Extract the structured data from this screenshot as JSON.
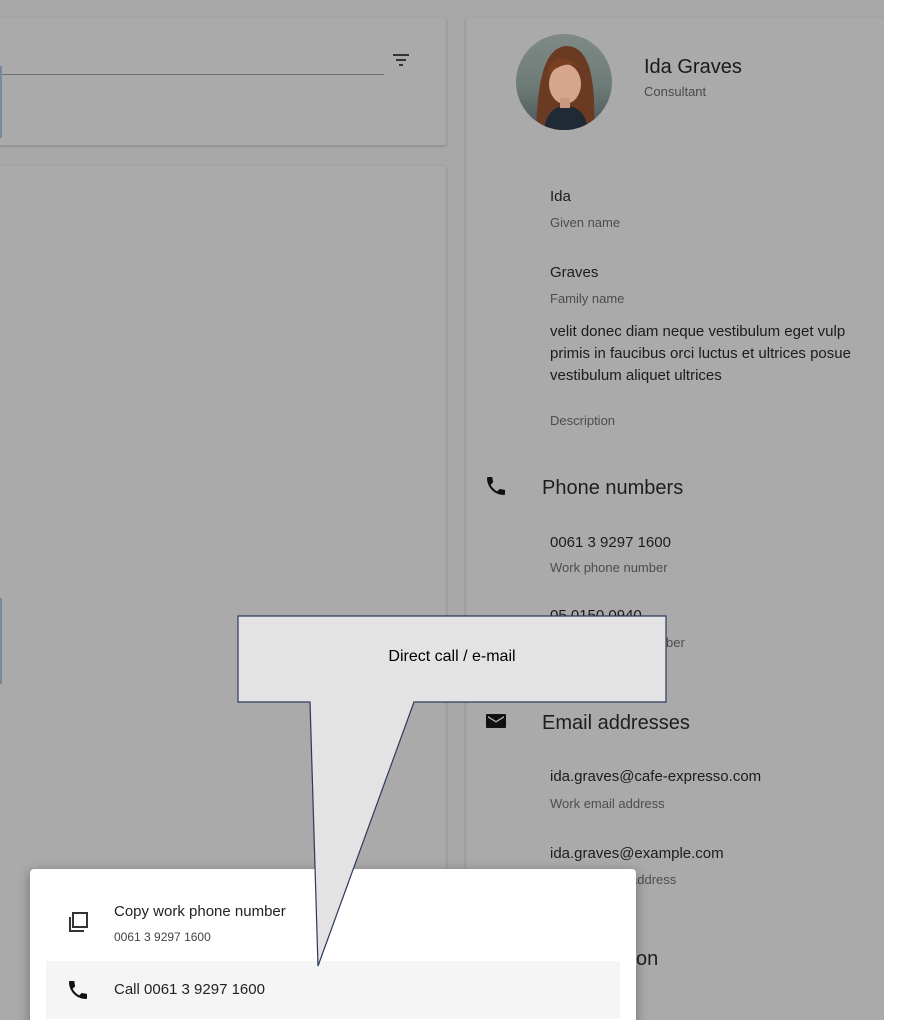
{
  "contact": {
    "name": "Ida Graves",
    "role": "Consultant",
    "fields": {
      "given_name": "Ida",
      "given_name_label": "Given name",
      "family_name": "Graves",
      "family_name_label": "Family name",
      "description_lines": [
        "velit donec diam neque vestibulum eget vulp",
        "primis in faucibus orci luctus et ultrices posue",
        "vestibulum aliquet ultrices"
      ],
      "description_label": "Description"
    },
    "phones": {
      "title": "Phone numbers",
      "items": [
        {
          "value": "0061 3 9297 1600",
          "label": "Work phone number"
        },
        {
          "value": "05 0150 0940",
          "label": "ber"
        }
      ]
    },
    "emails": {
      "title": "Email addresses",
      "items": [
        {
          "value": "ida.graves@cafe-expresso.com",
          "label": "Work email address"
        },
        {
          "value": "ida.graves@example.com",
          "label": "address"
        }
      ]
    },
    "next_section_partial": "on"
  },
  "popup": {
    "copy_title": "Copy work phone number",
    "copy_sub": "0061 3 9297 1600",
    "call_title": "Call 0061 3 9297 1600"
  },
  "callout": {
    "text": "Direct call / e-mail"
  },
  "icons": {
    "filter": "filter-list-icon",
    "phone": "phone-icon",
    "mail": "mail-icon",
    "copy": "copy-icon"
  },
  "colors": {
    "overlay": "#a8a8a8",
    "callout_fill": "#e3e3e3",
    "callout_border": "#2b3a5a",
    "marker": "#7a8899"
  }
}
